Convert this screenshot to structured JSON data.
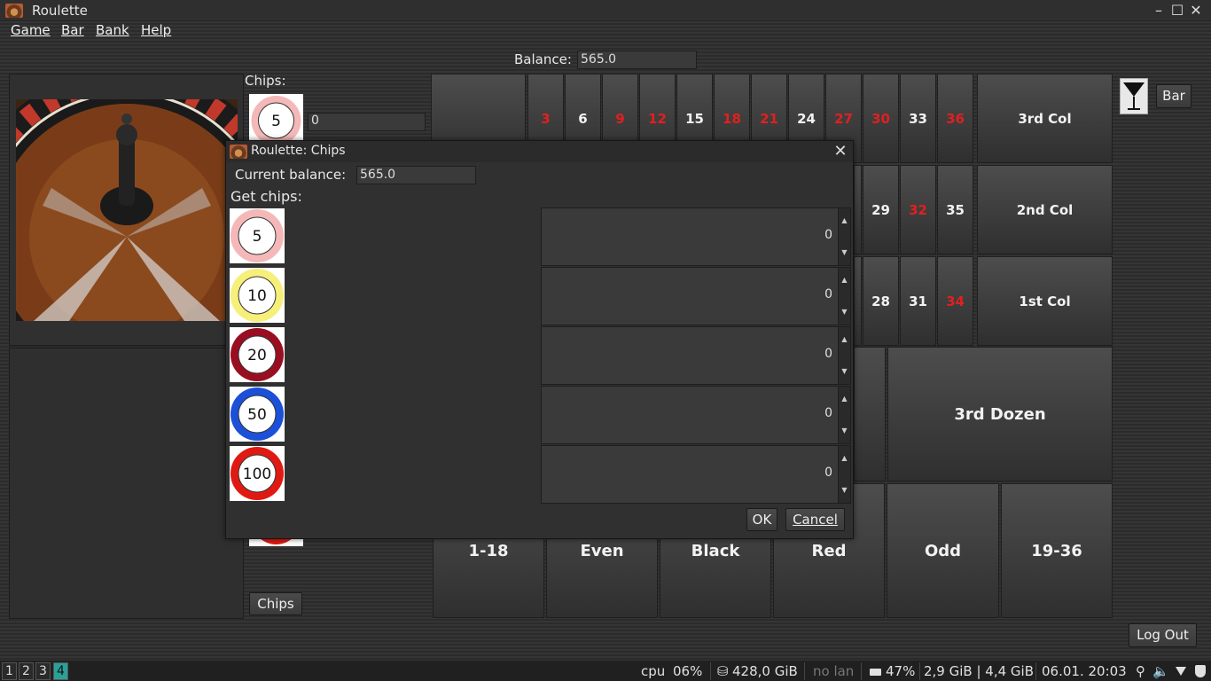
{
  "window": {
    "title": "Roulette",
    "minimize": "–",
    "maximize": "☐",
    "close": "✕"
  },
  "menu": [
    "Game",
    "Bar",
    "Bank",
    "Help"
  ],
  "balance": {
    "label": "Balance:",
    "value": "565.0"
  },
  "chips_panel": {
    "label": "Chips:",
    "chip_value": "5",
    "chip_count": "0",
    "chips_button": "Chips"
  },
  "board": {
    "zero_cell": "",
    "numbers_top": [
      {
        "n": "3",
        "color": "red"
      },
      {
        "n": "6",
        "color": "black"
      },
      {
        "n": "9",
        "color": "red"
      },
      {
        "n": "12",
        "color": "red"
      },
      {
        "n": "15",
        "color": "black"
      },
      {
        "n": "18",
        "color": "red"
      },
      {
        "n": "21",
        "color": "red"
      },
      {
        "n": "24",
        "color": "black"
      },
      {
        "n": "27",
        "color": "red"
      },
      {
        "n": "30",
        "color": "red"
      },
      {
        "n": "33",
        "color": "black"
      },
      {
        "n": "36",
        "color": "red"
      }
    ],
    "numbers_mid_visible": [
      {
        "n": "29",
        "color": "black"
      },
      {
        "n": "32",
        "color": "red"
      },
      {
        "n": "35",
        "color": "black"
      }
    ],
    "numbers_bot_visible": [
      {
        "n": "28",
        "color": "black"
      },
      {
        "n": "31",
        "color": "black"
      },
      {
        "n": "34",
        "color": "red"
      }
    ],
    "columns": [
      "3rd Col",
      "2nd Col",
      "1st Col"
    ],
    "dozen": "3rd Dozen",
    "outside": [
      "1-18",
      "Even",
      "Black",
      "Red",
      "Odd",
      "19-36"
    ]
  },
  "bar_button": "Bar",
  "logout_button": "Log Out",
  "dialog": {
    "title": "Roulette: Chips",
    "close": "✕",
    "current_balance_label": "Current balance:",
    "current_balance_value": "565.0",
    "get_chips_label": "Get chips:",
    "chips": [
      {
        "value": "5",
        "color": "#f4b8b8",
        "count": "0"
      },
      {
        "value": "10",
        "color": "#f6f07a",
        "count": "0"
      },
      {
        "value": "20",
        "color": "#9a0e22",
        "count": "0"
      },
      {
        "value": "50",
        "color": "#1c50d8",
        "count": "0"
      },
      {
        "value": "100",
        "color": "#e01a12",
        "count": "0"
      }
    ],
    "ok": "OK",
    "cancel": "Cancel"
  },
  "taskbar": {
    "workspaces": [
      "1",
      "2",
      "3",
      "4"
    ],
    "active_workspace": "4",
    "cpu_label": "cpu",
    "cpu_value": "06%",
    "disk": "428,0 GiB",
    "lan": "no lan",
    "battery": "47%",
    "memory": "2,9 GiB | 4,4 GiB",
    "datetime": "06.01. 20:03"
  }
}
